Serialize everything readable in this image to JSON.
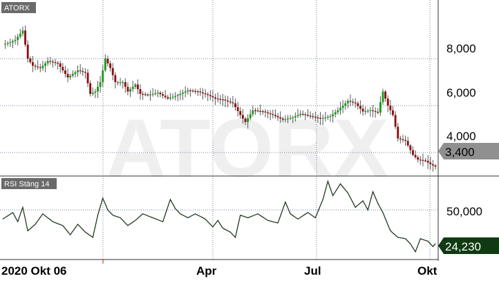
{
  "colors": {
    "up": "#1a9a1a",
    "down": "#8b1010",
    "rsi_line": "#1f3a1f",
    "grid": "#6d7f9a",
    "watermark": "#efefef",
    "price_tag": "#909090",
    "rsi_tag": "#0f3a12",
    "panel_label_bg": "#6a6a6a"
  },
  "chart_data": [
    {
      "type": "candlestick",
      "panel_label": "ATORX",
      "watermark": "ATORX",
      "y_ticks": [
        4000,
        6000,
        8000
      ],
      "y_tick_labels": [
        "4,000",
        "6,000",
        "8,000"
      ],
      "ylim": [
        3000,
        10500
      ],
      "grid": true,
      "last_value": 3400,
      "last_value_label": "3,400",
      "x_labels": [
        "2020 Okt 06",
        "Apr",
        "Jul",
        "Okt"
      ],
      "anchors": [
        [
          0,
          8600
        ],
        [
          3,
          8700
        ],
        [
          5,
          8800
        ],
        [
          8,
          9200
        ],
        [
          10,
          8000
        ],
        [
          12,
          7700
        ],
        [
          15,
          7600
        ],
        [
          18,
          7900
        ],
        [
          22,
          7800
        ],
        [
          26,
          7200
        ],
        [
          30,
          7500
        ],
        [
          33,
          7400
        ],
        [
          35,
          6500
        ],
        [
          37,
          6600
        ],
        [
          39,
          7000
        ],
        [
          41,
          8000
        ],
        [
          43,
          7600
        ],
        [
          45,
          7000
        ],
        [
          48,
          7000
        ],
        [
          50,
          6600
        ],
        [
          53,
          6900
        ],
        [
          55,
          6500
        ],
        [
          58,
          6450
        ],
        [
          62,
          6550
        ],
        [
          66,
          6300
        ],
        [
          70,
          6450
        ],
        [
          74,
          6650
        ],
        [
          78,
          6600
        ],
        [
          82,
          6450
        ],
        [
          85,
          6300
        ],
        [
          88,
          6250
        ],
        [
          92,
          6100
        ],
        [
          95,
          5600
        ],
        [
          97,
          5300
        ],
        [
          100,
          5800
        ],
        [
          104,
          5750
        ],
        [
          108,
          5600
        ],
        [
          112,
          5400
        ],
        [
          116,
          5500
        ],
        [
          119,
          5650
        ],
        [
          123,
          5550
        ],
        [
          127,
          5450
        ],
        [
          131,
          5550
        ],
        [
          134,
          5800
        ],
        [
          138,
          6200
        ],
        [
          141,
          6100
        ],
        [
          144,
          5750
        ],
        [
          147,
          5800
        ],
        [
          150,
          5700
        ],
        [
          152,
          6600
        ],
        [
          154,
          6000
        ],
        [
          156,
          5600
        ],
        [
          158,
          4600
        ],
        [
          161,
          4500
        ],
        [
          164,
          3900
        ],
        [
          166,
          3700
        ],
        [
          169,
          3650
        ],
        [
          171,
          3500
        ],
        [
          173,
          3400
        ]
      ]
    },
    {
      "type": "line",
      "panel_label": "RSI Stäng 14",
      "y_ticks": [
        50
      ],
      "y_tick_labels": [
        "50,000"
      ],
      "ylim": [
        12,
        76
      ],
      "grid": true,
      "last_value": 24.23,
      "last_value_label": "24,230",
      "anchors": [
        [
          0,
          43
        ],
        [
          4,
          48
        ],
        [
          6,
          41
        ],
        [
          8,
          52
        ],
        [
          10,
          34
        ],
        [
          13,
          39
        ],
        [
          16,
          47
        ],
        [
          20,
          41
        ],
        [
          24,
          38
        ],
        [
          27,
          31
        ],
        [
          30,
          39
        ],
        [
          33,
          33
        ],
        [
          36,
          29
        ],
        [
          38,
          46
        ],
        [
          40,
          59
        ],
        [
          42,
          50
        ],
        [
          44,
          46
        ],
        [
          47,
          44
        ],
        [
          50,
          38
        ],
        [
          53,
          42
        ],
        [
          56,
          47
        ],
        [
          60,
          44
        ],
        [
          64,
          41
        ],
        [
          67,
          58
        ],
        [
          69,
          51
        ],
        [
          71,
          47
        ],
        [
          74,
          44
        ],
        [
          77,
          47
        ],
        [
          81,
          43
        ],
        [
          84,
          37
        ],
        [
          86,
          42
        ],
        [
          88,
          36
        ],
        [
          91,
          33
        ],
        [
          93,
          29
        ],
        [
          95,
          46
        ],
        [
          98,
          44
        ],
        [
          102,
          47
        ],
        [
          106,
          42
        ],
        [
          110,
          40
        ],
        [
          113,
          56
        ],
        [
          115,
          47
        ],
        [
          118,
          43
        ],
        [
          122,
          48
        ],
        [
          125,
          44
        ],
        [
          128,
          58
        ],
        [
          130,
          72
        ],
        [
          132,
          61
        ],
        [
          135,
          70
        ],
        [
          138,
          63
        ],
        [
          141,
          52
        ],
        [
          144,
          57
        ],
        [
          146,
          50
        ],
        [
          148,
          64
        ],
        [
          150,
          55
        ],
        [
          152,
          48
        ],
        [
          155,
          34
        ],
        [
          158,
          29
        ],
        [
          161,
          28
        ],
        [
          163,
          24
        ],
        [
          165,
          18
        ],
        [
          167,
          28
        ],
        [
          170,
          26
        ],
        [
          172,
          22
        ],
        [
          173,
          24.23
        ]
      ]
    }
  ]
}
